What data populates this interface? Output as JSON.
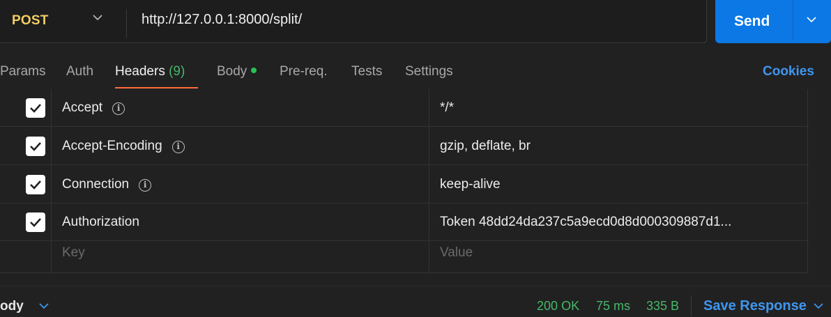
{
  "request": {
    "method": "POST",
    "url": "http://127.0.0.1:8000/split/",
    "send_label": "Send"
  },
  "tabs": [
    {
      "label": "Params"
    },
    {
      "label": "Auth"
    },
    {
      "label": "Headers",
      "count": "(9)",
      "active": true
    },
    {
      "label": "Body",
      "has_content_dot": true
    },
    {
      "label": "Pre-req."
    },
    {
      "label": "Tests"
    },
    {
      "label": "Settings"
    }
  ],
  "cookies_label": "Cookies",
  "headers": [
    {
      "checked": true,
      "key": "Accept",
      "info": true,
      "value": "*/*"
    },
    {
      "checked": true,
      "key": "Accept-Encoding",
      "info": true,
      "value": "gzip, deflate, br"
    },
    {
      "checked": true,
      "key": "Connection",
      "info": true,
      "value": "keep-alive"
    },
    {
      "checked": true,
      "key": "Authorization",
      "info": false,
      "value": "Token 48dd24da237c5a9ecd0d8d000309887d1..."
    }
  ],
  "new_row": {
    "key_placeholder": "Key",
    "value_placeholder": "Value"
  },
  "response": {
    "section_label": "ody",
    "status_code": "200",
    "status_text": "OK",
    "time": "75 ms",
    "size": "335 B",
    "save_label": "Save Response"
  },
  "colors": {
    "method": "#f2cd62",
    "send_bg": "#0b78e6",
    "active_tab_underline": "#ff6c37",
    "status_green": "#45b869",
    "link_blue": "#3f96f0"
  }
}
